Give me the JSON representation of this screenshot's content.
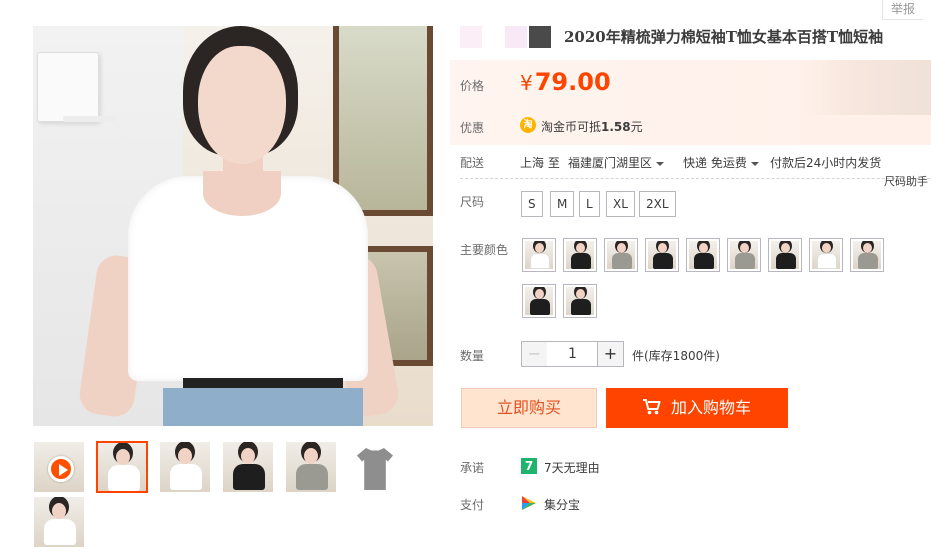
{
  "report_label": "举报",
  "product": {
    "title": "2020年精梳弹力棉短袖T恤女基本百搭T恤短袖",
    "title_swatch_colors": [
      "#fbeef7",
      "#f7e9f5",
      "#4a4a4a"
    ]
  },
  "price": {
    "label": "价格",
    "currency": "¥",
    "amount": "79.00",
    "accent_color": "#ff4400"
  },
  "discount": {
    "label": "优惠",
    "icon": "taobao-coin-icon",
    "icon_glyph": "淘",
    "prefix": "淘金币可抵",
    "amount": "1.58",
    "suffix": "元"
  },
  "shipping": {
    "label": "配送",
    "from": "上海 至",
    "to": "福建厦门湖里区",
    "method": "快递 免运费",
    "promise": "付款后24小时内发货"
  },
  "size_helper": "尺码助手",
  "size": {
    "label": "尺码",
    "options": [
      "S",
      "M",
      "L",
      "XL",
      "2XL"
    ]
  },
  "color": {
    "label": "主要颜色",
    "swatch_shirt_colors": [
      "#ffffff",
      "#1e1e1e",
      "#9a9a92",
      "#1e1e1e",
      "#1e1e1e",
      "#9a9a92",
      "#1e1e1e",
      "#ffffff",
      "#9a9a92",
      "#1e1e1e",
      "#1e1e1e"
    ]
  },
  "quantity": {
    "label": "数量",
    "minus": "−",
    "value": "1",
    "plus": "+",
    "stock": "件(库存1800件)"
  },
  "actions": {
    "buy_now": "立即购买",
    "add_to_cart": "加入购物车"
  },
  "guarantee": {
    "label": "承诺",
    "icon_glyph": "7",
    "text": "7天无理由"
  },
  "payment": {
    "label": "支付",
    "text": "集分宝"
  },
  "thumbnails": [
    {
      "kind": "video"
    },
    {
      "kind": "photo",
      "shirt": "#ffffff",
      "active": true
    },
    {
      "kind": "photo",
      "shirt": "#ffffff"
    },
    {
      "kind": "photo",
      "shirt": "#1e1e1e"
    },
    {
      "kind": "photo",
      "shirt": "#9a9a92"
    },
    {
      "kind": "flat",
      "shirt": "#8e8e8e"
    },
    {
      "kind": "photo",
      "shirt": "#ffffff"
    }
  ]
}
